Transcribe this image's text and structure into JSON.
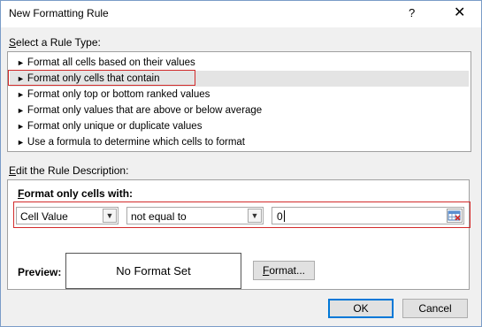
{
  "window": {
    "title": "New Formatting Rule",
    "help_glyph": "?",
    "close_glyph": "✕"
  },
  "rule_type": {
    "label": "Select a Rule Type:",
    "items": [
      {
        "label": "Format all cells based on their values",
        "selected": false
      },
      {
        "label": "Format only cells that contain",
        "selected": true
      },
      {
        "label": "Format only top or bottom ranked values",
        "selected": false
      },
      {
        "label": "Format only values that are above or below average",
        "selected": false
      },
      {
        "label": "Format only unique or duplicate values",
        "selected": false
      },
      {
        "label": "Use a formula to determine which cells to format",
        "selected": false
      }
    ]
  },
  "description": {
    "label": "Edit the Rule Description:",
    "condition_label": "Format only cells with:",
    "field_select": "Cell Value",
    "operator_select": "not equal to",
    "value_input": "0",
    "preview_label": "Preview:",
    "preview_text": "No Format Set",
    "format_button": "Format..."
  },
  "footer": {
    "ok": "OK",
    "cancel": "Cancel"
  },
  "colors": {
    "highlight_border": "#d22b2b",
    "selected_row": "#e4e4e4",
    "default_button_border": "#0078d7"
  }
}
